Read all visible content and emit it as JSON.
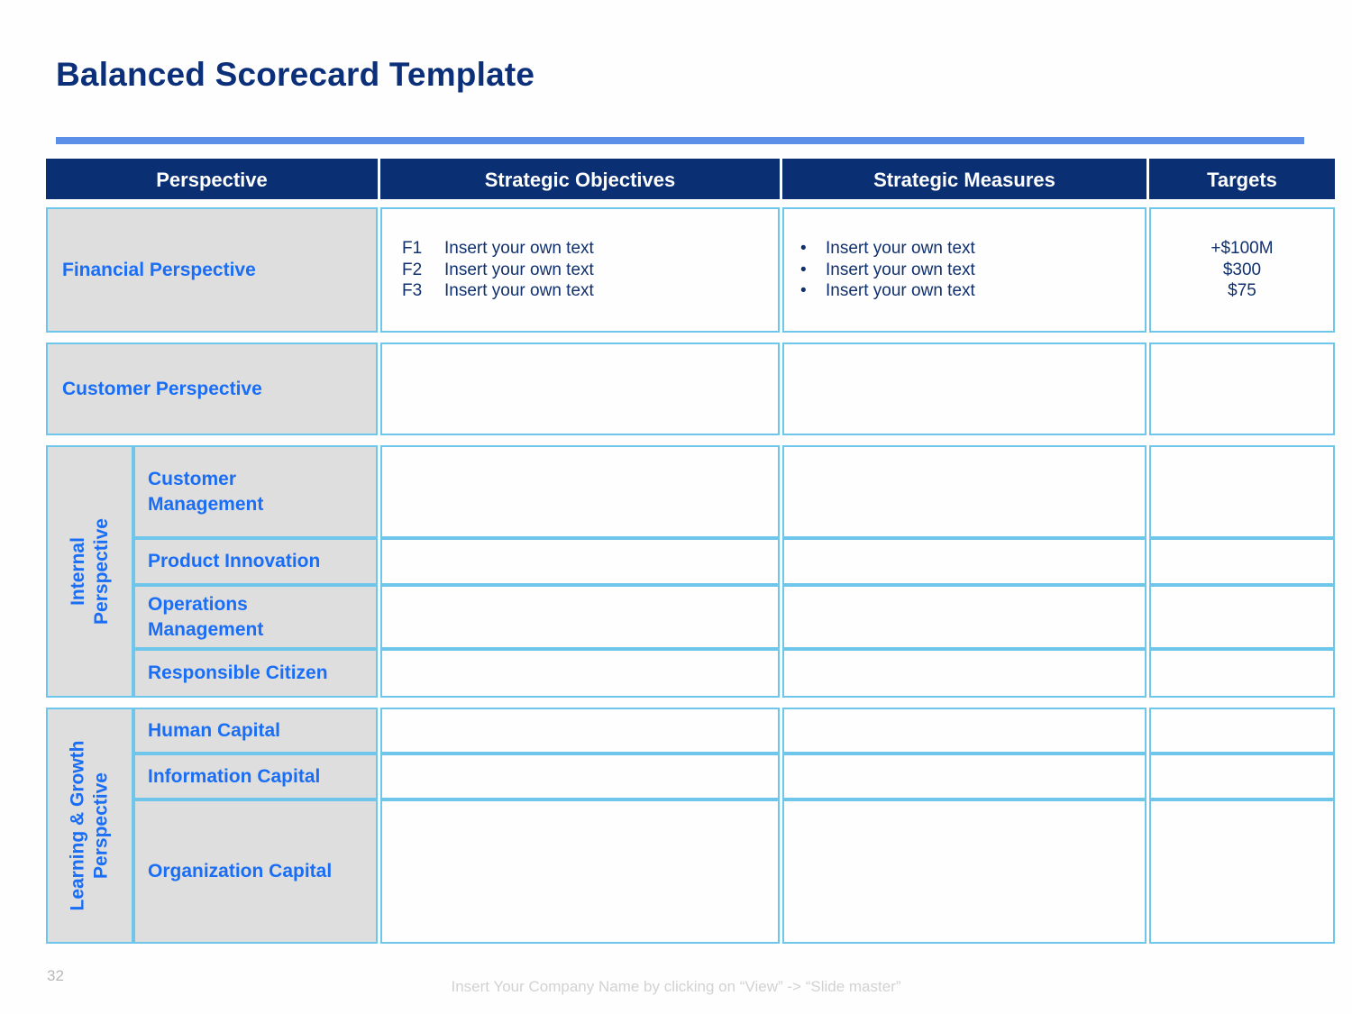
{
  "slide": {
    "title": "Balanced Scorecard Template",
    "accent_navy": "#0a2f72",
    "accent_blue": "#1a6ef5",
    "border_blue": "#6ec6ea",
    "rule_blue": "#5b8fe8",
    "cell_grey": "#dedede"
  },
  "table": {
    "headers": {
      "perspective": "Perspective",
      "objectives": "Strategic Objectives",
      "measures": "Strategic Measures",
      "targets": "Targets"
    },
    "financial": {
      "label": "Financial Perspective",
      "objectives": [
        {
          "code": "F1",
          "text": "Insert your own text"
        },
        {
          "code": "F2",
          "text": "Insert your own text"
        },
        {
          "code": "F3",
          "text": "Insert your own text"
        }
      ],
      "measures": [
        {
          "bullet": "•",
          "text": "Insert your own text"
        },
        {
          "bullet": "•",
          "text": "Insert your own text"
        },
        {
          "bullet": "•",
          "text": "Insert your own text"
        }
      ],
      "targets": [
        "+$100M",
        "$300",
        "$75"
      ]
    },
    "customer": {
      "label": "Customer Perspective",
      "objectives": "",
      "measures": "",
      "targets": ""
    },
    "internal": {
      "label_line1": "Internal",
      "label_line2": "Perspective",
      "rows": [
        {
          "label": "Customer\nManagement",
          "objectives": "",
          "measures": "",
          "targets": ""
        },
        {
          "label": "Product Innovation",
          "objectives": "",
          "measures": "",
          "targets": ""
        },
        {
          "label": "Operations\nManagement",
          "objectives": "",
          "measures": "",
          "targets": ""
        },
        {
          "label": "Responsible Citizen",
          "objectives": "",
          "measures": "",
          "targets": ""
        }
      ]
    },
    "learning": {
      "label_line1": "Learning & Growth",
      "label_line2": "Perspective",
      "rows": [
        {
          "label": "Human Capital",
          "objectives": "",
          "measures": "",
          "targets": ""
        },
        {
          "label": "Information Capital",
          "objectives": "",
          "measures": "",
          "targets": ""
        },
        {
          "label": "Organization Capital",
          "objectives": "",
          "measures": "",
          "targets": ""
        }
      ]
    }
  },
  "footer": {
    "page_number": "32",
    "note": "Insert Your Company Name by clicking on “View” -> “Slide master”"
  }
}
